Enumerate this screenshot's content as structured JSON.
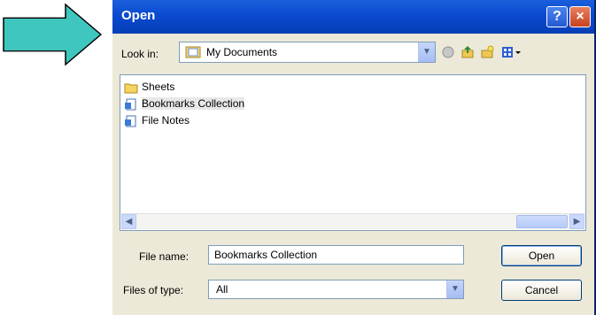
{
  "dialog": {
    "title": "Open",
    "help_glyph": "?",
    "close_glyph": "×"
  },
  "lookin": {
    "label": "Look in:",
    "value": "My Documents"
  },
  "toolbar": {
    "icons": [
      "back-icon",
      "up-folder-icon",
      "new-folder-icon",
      "views-icon"
    ]
  },
  "files": [
    {
      "name": "Sheets",
      "icon": "folder-icon"
    },
    {
      "name": "Bookmarks Collection",
      "icon": "document-icon"
    },
    {
      "name": "File Notes",
      "icon": "document-icon"
    }
  ],
  "filename": {
    "label": "File name:",
    "value": "Bookmarks Collection"
  },
  "filetype": {
    "label": "Files of type:",
    "value": "All"
  },
  "buttons": {
    "open": "Open",
    "cancel": "Cancel"
  },
  "colors": {
    "pointer_arrow": "#3fc6be",
    "title_bar": "#0a4ad0",
    "dialog_bg": "#ece9d8"
  }
}
